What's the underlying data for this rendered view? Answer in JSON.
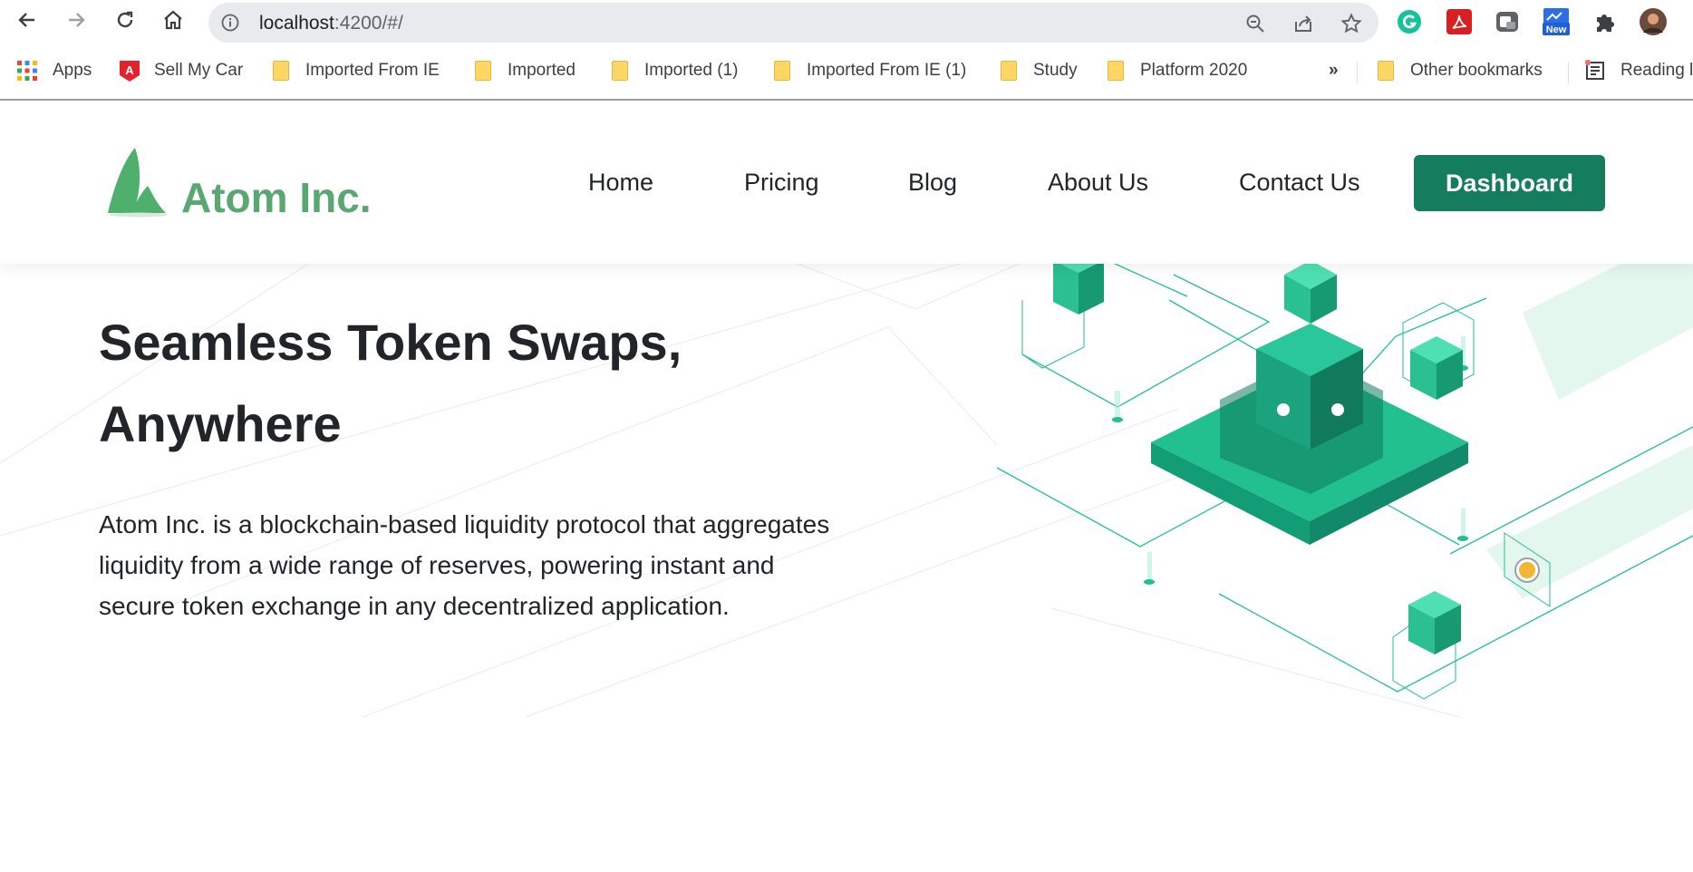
{
  "browser": {
    "url_host": "localhost",
    "url_path": ":4200/#/",
    "ext_new_badge": "New",
    "bookmarks": [
      {
        "label": "Apps",
        "icon": "apps-grid-icon"
      },
      {
        "label": "Sell My Car",
        "icon": "autotrader-icon"
      },
      {
        "label": "Imported From IE",
        "icon": "folder-icon"
      },
      {
        "label": "Imported",
        "icon": "folder-icon"
      },
      {
        "label": "Imported (1)",
        "icon": "folder-icon"
      },
      {
        "label": "Imported From IE (1)",
        "icon": "folder-icon"
      },
      {
        "label": "Study",
        "icon": "folder-icon"
      },
      {
        "label": "Platform 2020",
        "icon": "folder-icon"
      }
    ],
    "overflow": "»",
    "other_bookmarks": "Other bookmarks",
    "reading_list": "Reading l"
  },
  "site": {
    "brand": "Atom Inc.",
    "nav": [
      "Home",
      "Pricing",
      "Blog",
      "About Us",
      "Contact Us"
    ],
    "cta": "Dashboard",
    "hero_title_line1": "Seamless Token Swaps,",
    "hero_title_line2": "Anywhere",
    "hero_description": "Atom Inc. is a blockchain-based liquidity protocol that aggregates liquidity from a wide range of reserves, powering instant and secure token exchange in any decentralized application."
  },
  "colors": {
    "brand_green": "#5aa772",
    "cta_bg": "#137d5e",
    "illustration_green": "#22c08f"
  }
}
